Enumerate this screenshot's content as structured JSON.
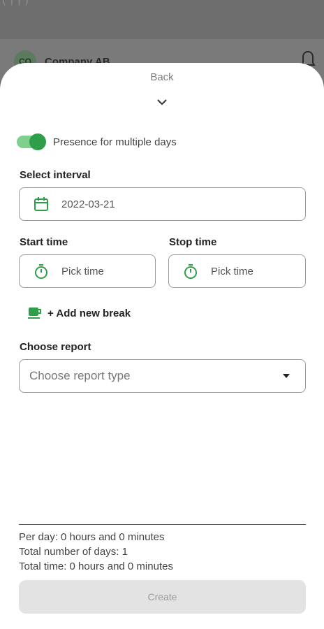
{
  "background": {
    "avatar_initials": "CO",
    "company_name": "Company AB"
  },
  "sheet": {
    "back_label": "Back",
    "multiple_days_toggle": {
      "label": "Presence for multiple days",
      "on": true
    },
    "interval": {
      "label": "Select interval",
      "date_value": "2022-03-21"
    },
    "start_time": {
      "label": "Start time",
      "placeholder": "Pick time"
    },
    "stop_time": {
      "label": "Stop time",
      "placeholder": "Pick time"
    },
    "add_break_label": "+ Add new break",
    "report": {
      "label": "Choose report",
      "placeholder": "Choose report type"
    },
    "summary": {
      "per_day": "Per day: 0 hours and 0 minutes",
      "total_days": "Total number of days: 1",
      "total_time": "Total time: 0 hours and 0 minutes"
    },
    "create_label": "Create"
  },
  "colors": {
    "accent": "#2e9e48",
    "accent_light": "#7fcf8d",
    "disabled_button": "#e3e3e3"
  },
  "icons": [
    "calendar-icon",
    "stopwatch-icon",
    "coffee-cup-icon",
    "chevron-down-icon",
    "dropdown-caret-icon",
    "bell-icon"
  ]
}
